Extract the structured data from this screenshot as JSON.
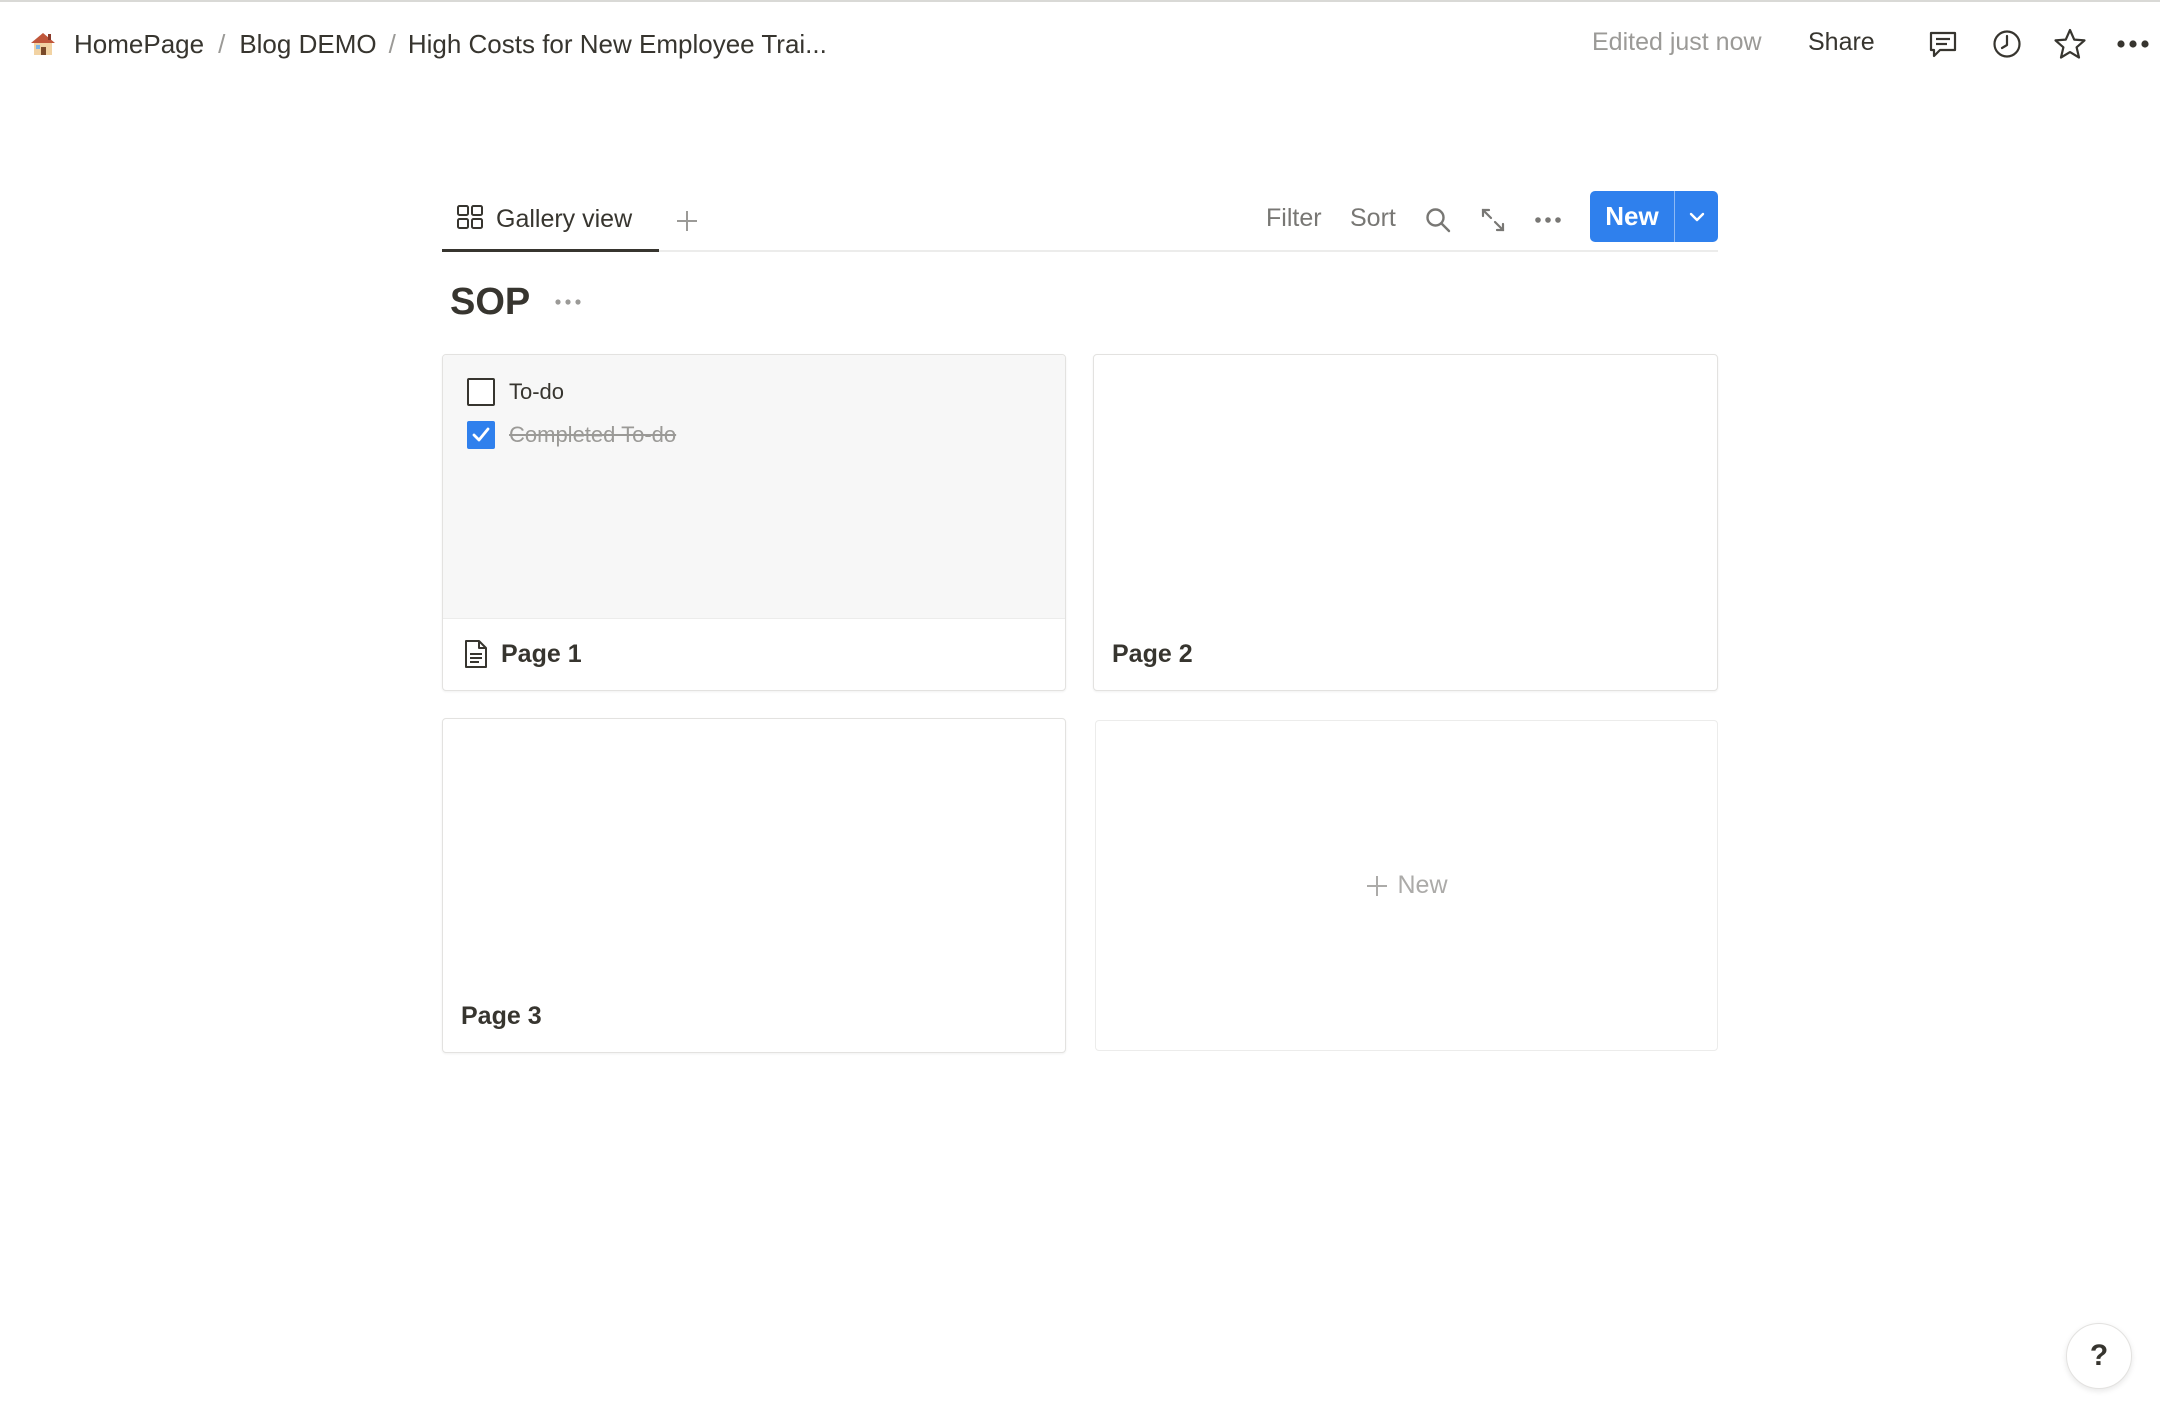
{
  "breadcrumb": {
    "items": [
      {
        "label": "HomePage",
        "icon": "house-emoji-icon"
      },
      {
        "label": "Blog DEMO"
      },
      {
        "label": "High Costs for New Employee Trai..."
      }
    ],
    "separator": "/"
  },
  "topbar": {
    "edited_status": "Edited just now",
    "share_label": "Share",
    "icons": [
      "comment-icon",
      "clock-history-icon",
      "star-icon",
      "more-horizontal-icon"
    ]
  },
  "database": {
    "view_tab_label": "Gallery view",
    "view_tab_icon": "gallery-grid-icon",
    "toolbar": {
      "filter_label": "Filter",
      "sort_label": "Sort",
      "new_label": "New"
    },
    "title": "SOP",
    "cards": [
      {
        "title": "Page 1",
        "has_page_icon": true,
        "todos": [
          {
            "label": "To-do",
            "checked": false
          },
          {
            "label": "Completed To-do",
            "checked": true
          }
        ]
      },
      {
        "title": "Page 2",
        "has_page_icon": false,
        "todos": []
      },
      {
        "title": "Page 3",
        "has_page_icon": false,
        "todos": []
      }
    ],
    "new_card_label": "New"
  },
  "help_label": "?",
  "colors": {
    "accent": "#2f80ed",
    "text": "#37352f",
    "muted": "#9b9a97",
    "border": "#e3e2e0"
  }
}
